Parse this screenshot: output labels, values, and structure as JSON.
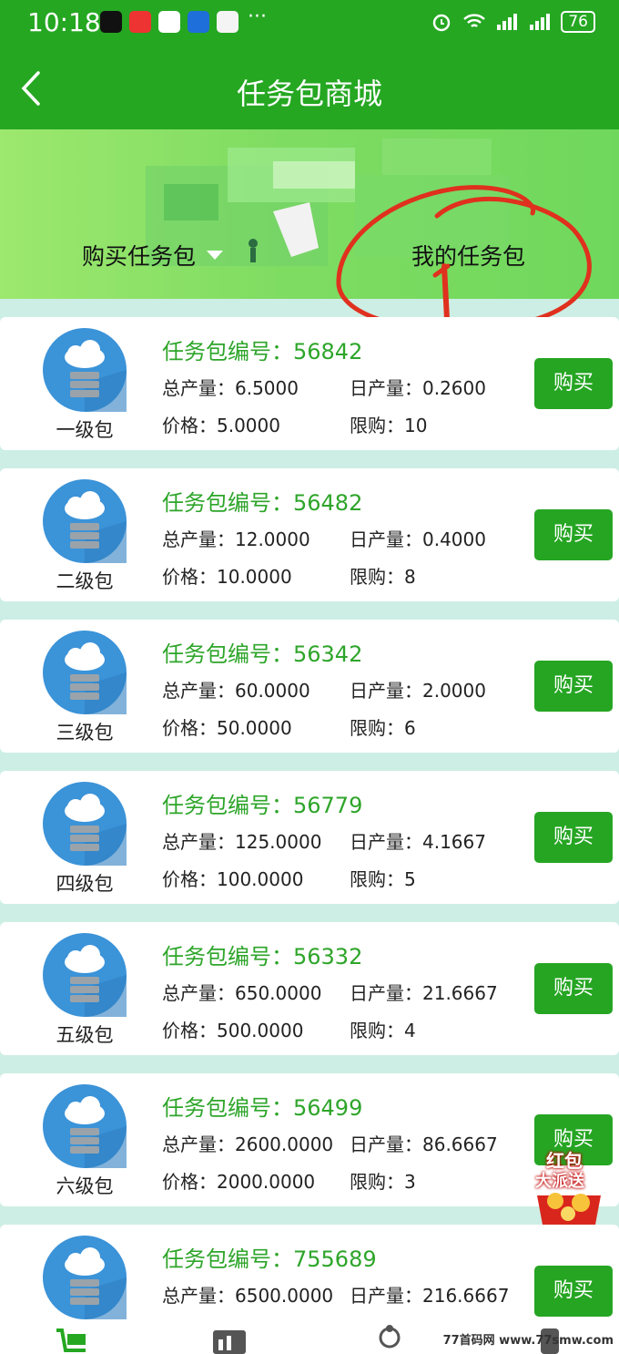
{
  "status": {
    "time": "10:18",
    "battery": "76"
  },
  "header": {
    "title": "任务包商城"
  },
  "tabs": {
    "buy": "购买任务包",
    "mine": "我的任务包"
  },
  "labels": {
    "code": "任务包编号：",
    "total": "总产量：",
    "daily": "日产量：",
    "price": "价格：",
    "limit": "限购：",
    "buy": "购买"
  },
  "packages": [
    {
      "level": "一级包",
      "code": "56842",
      "total": "6.5000",
      "daily": "0.2600",
      "price": "5.0000",
      "limit": "10"
    },
    {
      "level": "二级包",
      "code": "56482",
      "total": "12.0000",
      "daily": "0.4000",
      "price": "10.0000",
      "limit": "8"
    },
    {
      "level": "三级包",
      "code": "56342",
      "total": "60.0000",
      "daily": "2.0000",
      "price": "50.0000",
      "limit": "6"
    },
    {
      "level": "四级包",
      "code": "56779",
      "total": "125.0000",
      "daily": "4.1667",
      "price": "100.0000",
      "limit": "5"
    },
    {
      "level": "五级包",
      "code": "56332",
      "total": "650.0000",
      "daily": "21.6667",
      "price": "500.0000",
      "limit": "4"
    },
    {
      "level": "六级包",
      "code": "56499",
      "total": "2600.0000",
      "daily": "86.6667",
      "price": "2000.0000",
      "limit": "3"
    },
    {
      "level": "",
      "code": "755689",
      "total": "6500.0000",
      "daily": "216.6667",
      "price": "",
      "limit": ""
    }
  ],
  "promo": {
    "redpacket_line1": "红包",
    "redpacket_line2": "大派送"
  },
  "watermark": "77首码网  www.77smw.com",
  "colors": {
    "primary_green": "#25a722",
    "code_green": "#2ea52a",
    "annotation_red": "#e0301e"
  }
}
